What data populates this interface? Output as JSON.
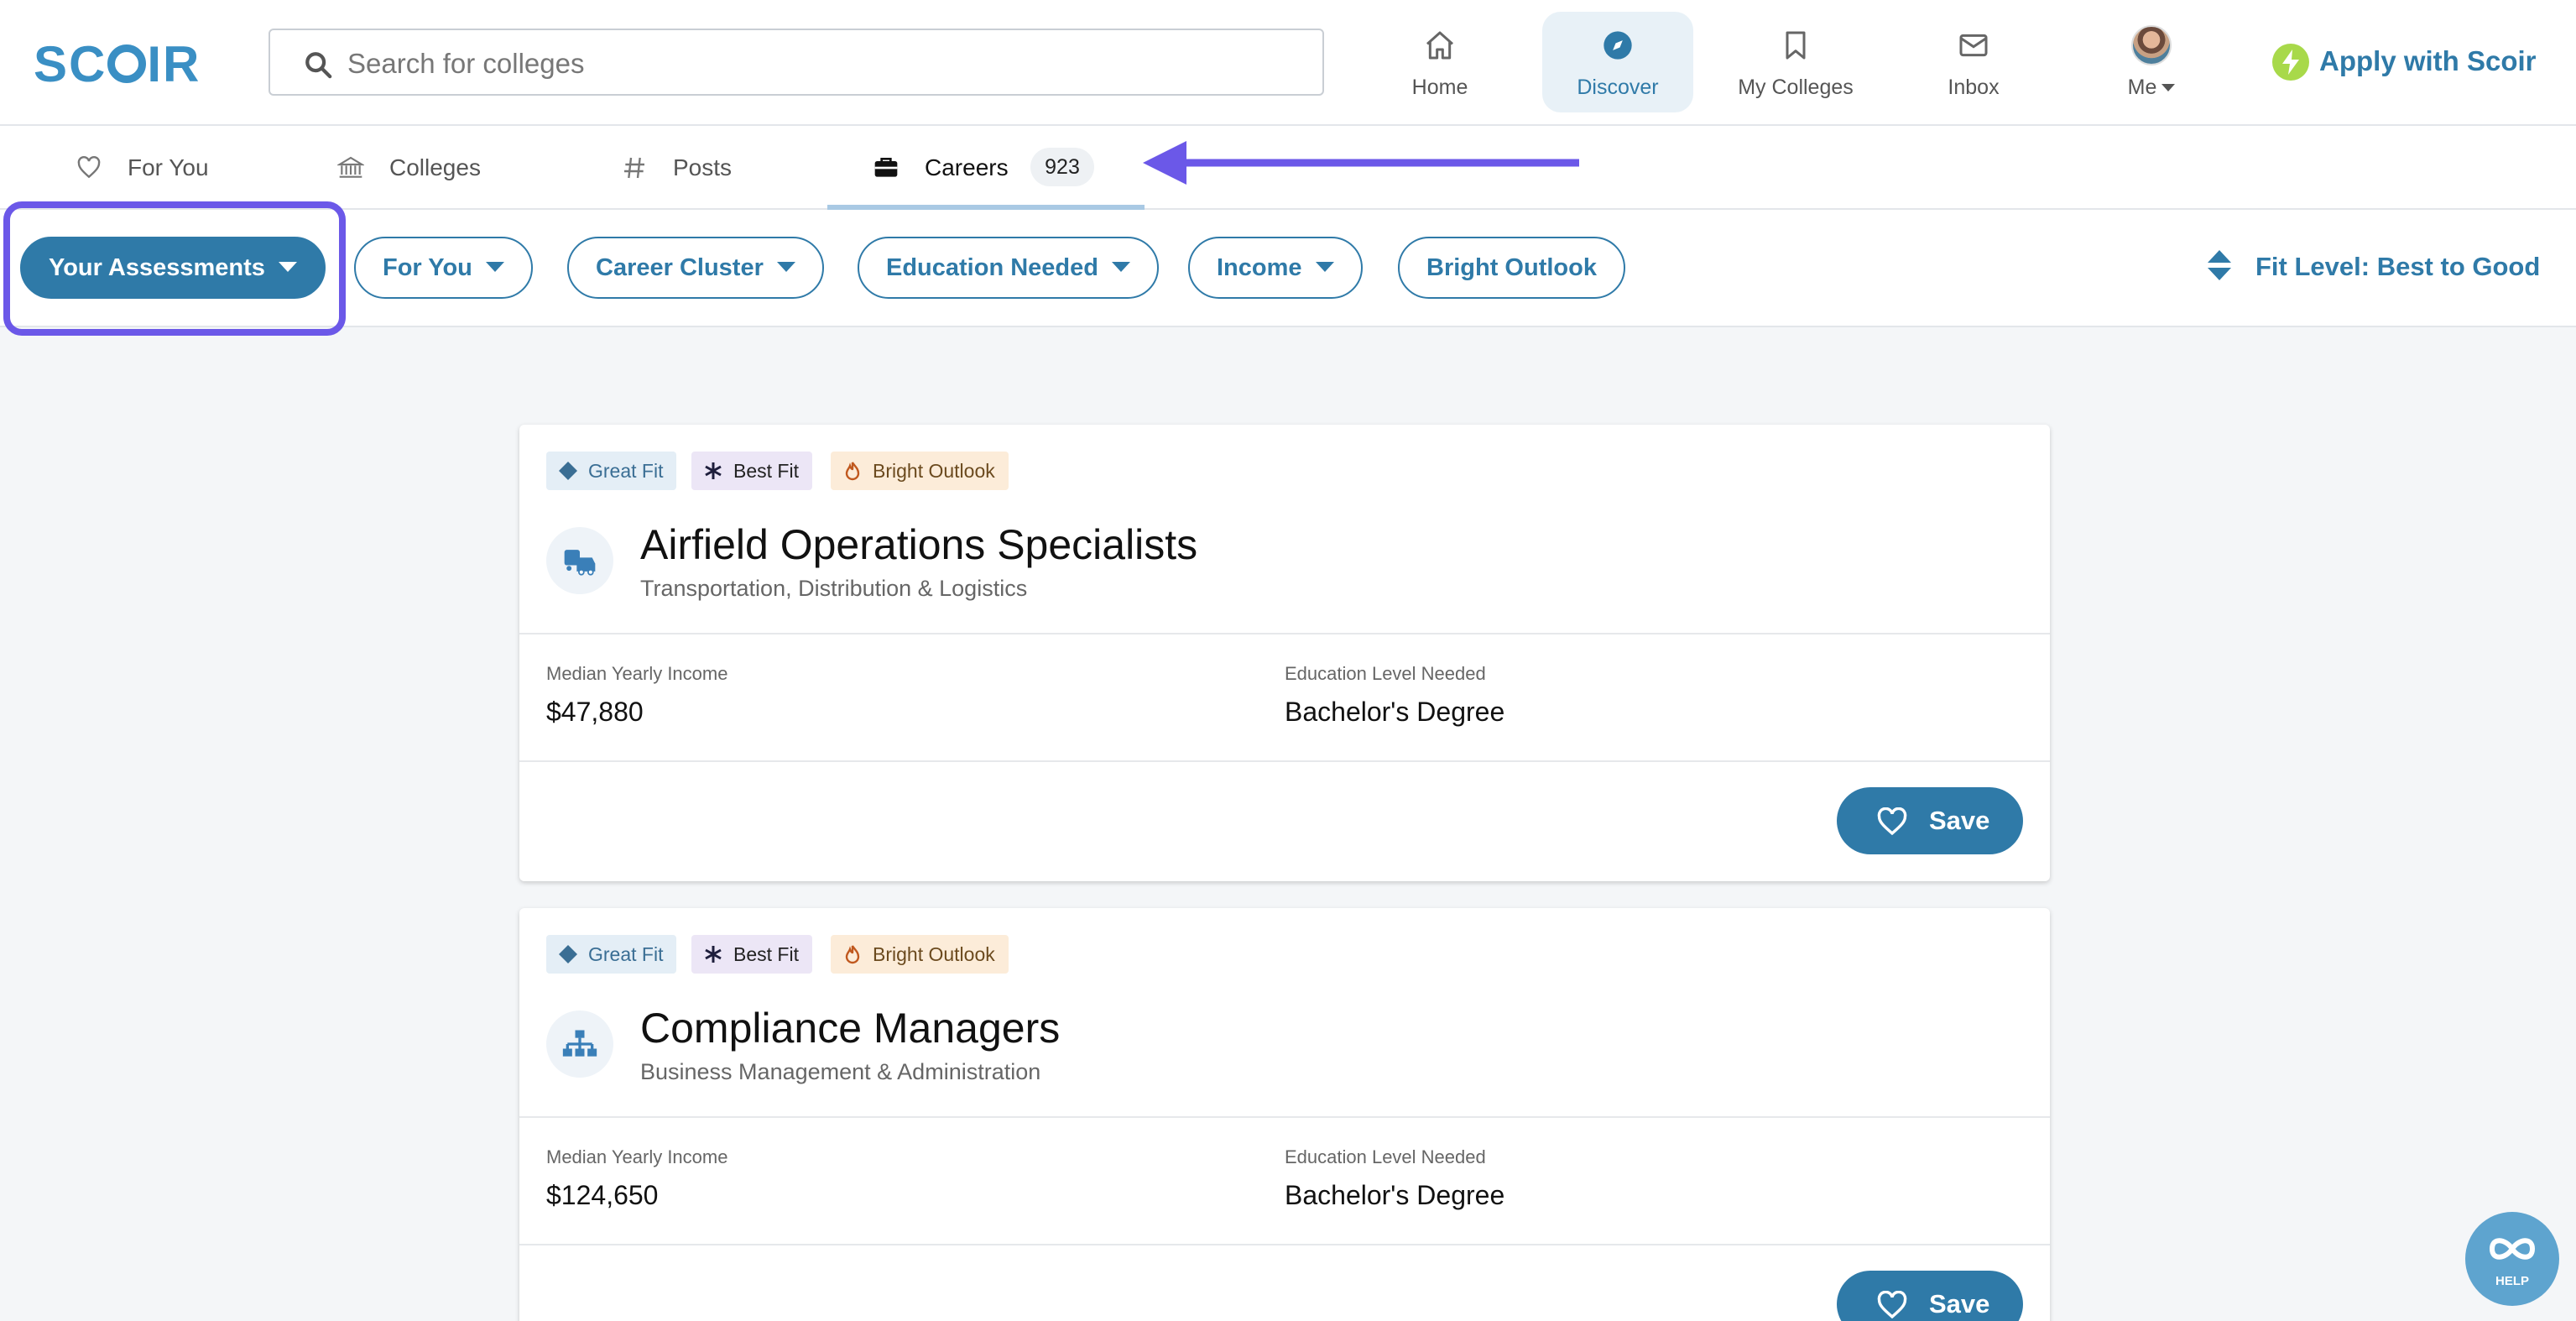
{
  "app": {
    "logo": "SCOIR"
  },
  "search": {
    "placeholder": "Search for colleges"
  },
  "nav": {
    "items": [
      {
        "label": "Home",
        "icon": "home-icon"
      },
      {
        "label": "Discover",
        "icon": "compass-icon",
        "active": true
      },
      {
        "label": "My Colleges",
        "icon": "bookmark-icon"
      },
      {
        "label": "Inbox",
        "icon": "mail-icon"
      },
      {
        "label": "Me",
        "icon": "avatar"
      }
    ],
    "apply_label": "Apply with Scoir"
  },
  "tabs": {
    "items": [
      {
        "label": "For You",
        "icon": "heart-icon"
      },
      {
        "label": "Colleges",
        "icon": "institution-icon"
      },
      {
        "label": "Posts",
        "icon": "hash-icon"
      },
      {
        "label": "Careers",
        "icon": "briefcase-icon",
        "active": true,
        "count": "923"
      }
    ]
  },
  "filters": {
    "items": [
      {
        "label": "Your Assessments",
        "dropdown": true,
        "primary": true
      },
      {
        "label": "For You",
        "dropdown": true
      },
      {
        "label": "Career Cluster",
        "dropdown": true
      },
      {
        "label": "Education Needed",
        "dropdown": true
      },
      {
        "label": "Income",
        "dropdown": true
      },
      {
        "label": "Bright Outlook",
        "dropdown": false
      }
    ],
    "sort_label": "Fit Level: Best to Good"
  },
  "careers": [
    {
      "badges": [
        "Great Fit",
        "Best Fit",
        "Bright Outlook"
      ],
      "title": "Airfield Operations Specialists",
      "cluster": "Transportation, Distribution & Logistics",
      "income_label": "Median Yearly Income",
      "income": "$47,880",
      "education_label": "Education Level Needed",
      "education": "Bachelor's Degree",
      "save_label": "Save"
    },
    {
      "badges": [
        "Great Fit",
        "Best Fit",
        "Bright Outlook"
      ],
      "title": "Compliance Managers",
      "cluster": "Business Management & Administration",
      "income_label": "Median Yearly Income",
      "income": "$124,650",
      "education_label": "Education Level Needed",
      "education": "Bachelor's Degree",
      "save_label": "Save"
    }
  ],
  "help": {
    "label": "HELP"
  },
  "colors": {
    "accent": "#2f7aa8",
    "highlight": "#6b58e8",
    "bolt": "#a8d94a"
  }
}
